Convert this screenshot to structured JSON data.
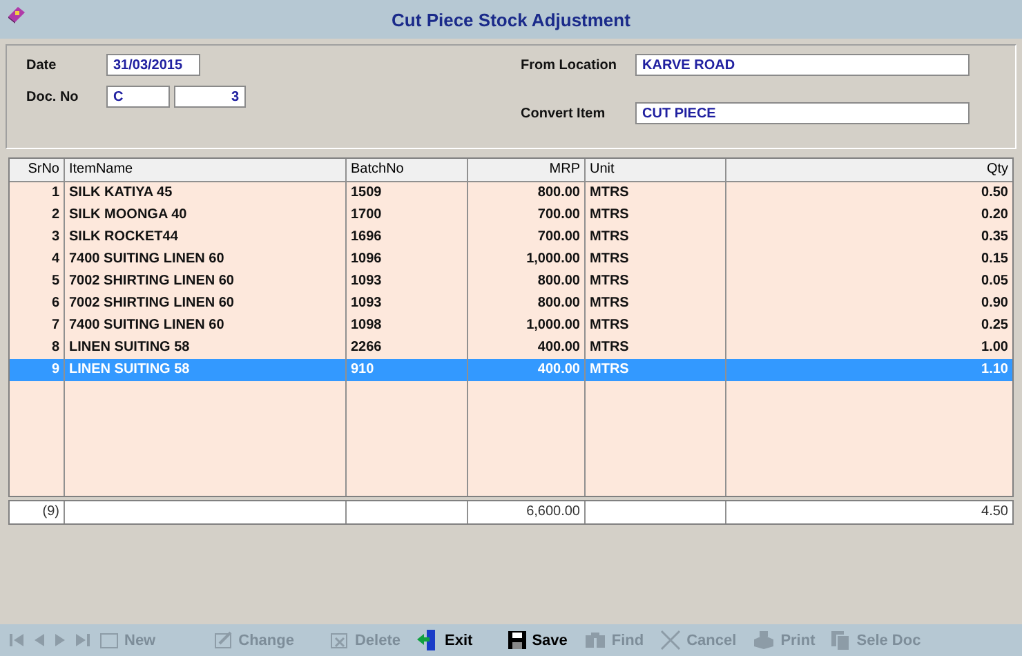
{
  "window": {
    "title": "Cut Piece Stock Adjustment"
  },
  "header": {
    "left": [
      {
        "label": "Date",
        "values": [
          "31/03/2015"
        ]
      },
      {
        "label": "Doc. No",
        "values": [
          "C",
          "3"
        ]
      }
    ],
    "right": [
      {
        "label": "From Location",
        "values": [
          "KARVE ROAD"
        ]
      },
      {
        "label": "Convert Item",
        "values": [
          "CUT PIECE"
        ]
      }
    ]
  },
  "table": {
    "columns": [
      "SrNo",
      "ItemName",
      "BatchNo",
      "MRP",
      "Unit",
      "Qty"
    ],
    "rows": [
      {
        "cells": [
          "1",
          "SILK KATIYA 45",
          "1509",
          "800.00",
          "MTRS",
          "0.50"
        ],
        "selected": false
      },
      {
        "cells": [
          "2",
          "SILK MOONGA 40",
          "1700",
          "700.00",
          "MTRS",
          "0.20"
        ],
        "selected": false
      },
      {
        "cells": [
          "3",
          "SILK ROCKET44",
          "1696",
          "700.00",
          "MTRS",
          "0.35"
        ],
        "selected": false
      },
      {
        "cells": [
          "4",
          "7400 SUITING LINEN 60",
          "1096",
          "1,000.00",
          "MTRS",
          "0.15"
        ],
        "selected": false
      },
      {
        "cells": [
          "5",
          "7002 SHIRTING LINEN 60",
          "1093",
          "800.00",
          "MTRS",
          "0.05"
        ],
        "selected": false
      },
      {
        "cells": [
          "6",
          "7002 SHIRTING LINEN 60",
          "1093",
          "800.00",
          "MTRS",
          "0.90"
        ],
        "selected": false
      },
      {
        "cells": [
          "7",
          "7400 SUITING LINEN 60",
          "1098",
          "1,000.00",
          "MTRS",
          "0.25"
        ],
        "selected": false
      },
      {
        "cells": [
          "8",
          "LINEN SUITING 58",
          "2266",
          "400.00",
          "MTRS",
          "1.00"
        ],
        "selected": false
      },
      {
        "cells": [
          "9",
          "LINEN SUITING 58",
          "910",
          "400.00",
          "MTRS",
          "1.10"
        ],
        "selected": true
      }
    ],
    "totals": {
      "srno": "(9)",
      "mrp": "6,600.00",
      "qty": "4.50"
    }
  },
  "toolbar": [
    {
      "kind": "first",
      "disabled": true
    },
    {
      "kind": "prev",
      "disabled": true
    },
    {
      "kind": "next",
      "disabled": true
    },
    {
      "kind": "last",
      "disabled": true
    },
    {
      "kind": "new",
      "label": "New",
      "disabled": true
    },
    {
      "kind": "change",
      "label": "Change",
      "disabled": true
    },
    {
      "kind": "delete",
      "label": "Delete",
      "disabled": true
    },
    {
      "kind": "exit",
      "label": "Exit",
      "disabled": false
    },
    {
      "kind": "save",
      "label": "Save",
      "disabled": false
    },
    {
      "kind": "find",
      "label": "Find",
      "disabled": true
    },
    {
      "kind": "cancel",
      "label": "Cancel",
      "disabled": true
    },
    {
      "kind": "print",
      "label": "Print",
      "disabled": true
    },
    {
      "kind": "seledoc",
      "label": "Sele Doc",
      "disabled": true
    }
  ]
}
